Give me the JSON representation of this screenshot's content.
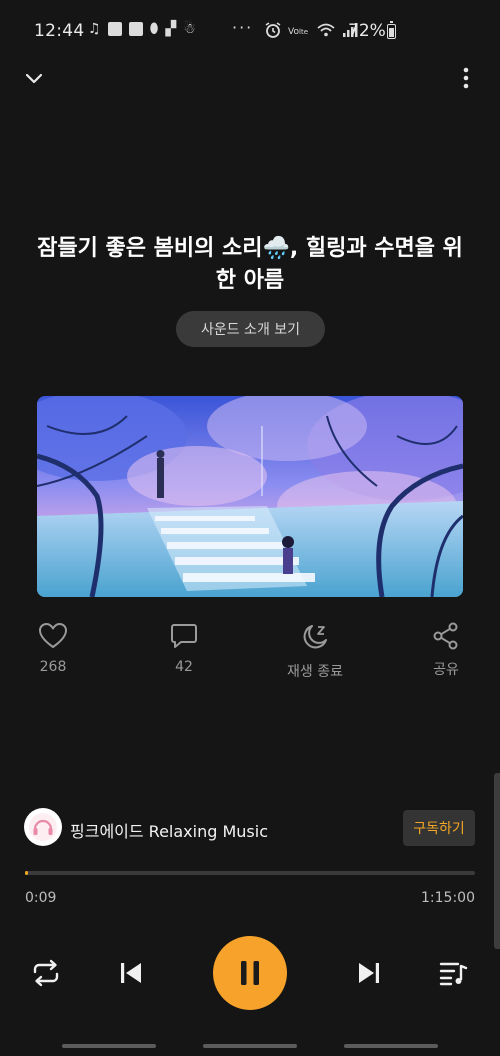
{
  "status_bar": {
    "time": "12:44",
    "battery": "72%",
    "dots": "···"
  },
  "header": {
    "collapse_icon": "chevron-down-icon",
    "more_icon": "more-vertical-icon"
  },
  "track": {
    "title": "잠들기 좋은 봄비의 소리🌧️, 힐링과 수면을 위한 아름",
    "intro_button": "사운드 소개 보기",
    "artwork": "anime-style rainy spring crosswalk illustration"
  },
  "actions": [
    {
      "icon": "heart-icon",
      "label": "268"
    },
    {
      "icon": "comment-icon",
      "label": "42"
    },
    {
      "icon": "sleep-timer-icon",
      "label": "재생 종료"
    },
    {
      "icon": "share-icon",
      "label": "공유"
    }
  ],
  "channel": {
    "name": "핑크에이드 Relaxing Music",
    "subscribe_label": "구독하기"
  },
  "player": {
    "current_time": "0:09",
    "total_time": "1:15:00",
    "progress": 0.002,
    "accent_color": "#f5a623"
  }
}
